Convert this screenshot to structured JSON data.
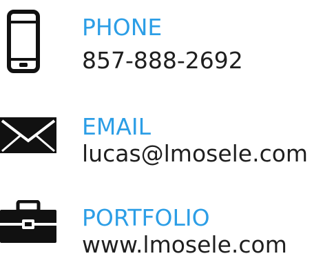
{
  "accent_color": "#2c9ee6",
  "text_color": "#1f1f1f",
  "icon_color": "#111111",
  "contacts": [
    {
      "icon": "smartphone-icon",
      "label": "PHONE",
      "value": "857-888-2692"
    },
    {
      "icon": "envelope-icon",
      "label": "EMAIL",
      "value": "lucas@lmosele.com"
    },
    {
      "icon": "briefcase-icon",
      "label": "PORTFOLIO",
      "value": "www.lmosele.com"
    }
  ]
}
